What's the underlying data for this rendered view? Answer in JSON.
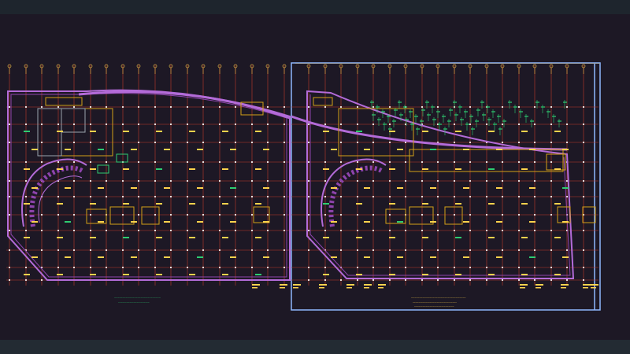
{
  "window": {
    "title": ""
  },
  "drawing": {
    "background": "#1d1825",
    "colors": {
      "grid": "#c0392b",
      "outline": "#b36bd8",
      "wall": "#8e44ad",
      "text": "#ffd34d",
      "annotation": "#2ecc71",
      "viewport_frame": "#8fb8ff",
      "room": "#d4a017"
    },
    "left_plan": {
      "caption_line1": "~~~~~~~~~~~~~~~~~~~~~~~~~~~~",
      "caption_line2": "~~~~~~~~~~~~~~~~~~~~~~"
    },
    "right_plan": {
      "caption_line1": "~~~~~~~~~~~~~~~~~~~~~~~~~~~~~~~~~",
      "caption_line2": "~~~~~~~~~~~~~~~~~~~~~~~~~~~~~~~",
      "caption_line3": "~~~~~~~~~~~~~~~~~~~~~~~~~~~~"
    }
  }
}
